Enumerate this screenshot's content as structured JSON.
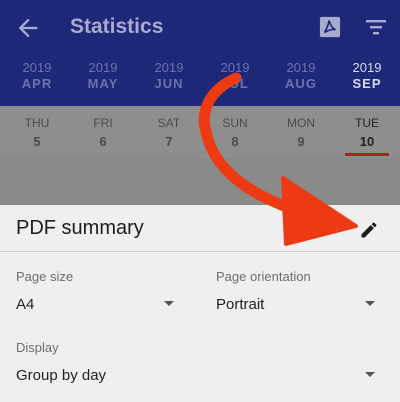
{
  "header": {
    "title": "Statistics",
    "back_icon": "arrow-left-icon",
    "pdf_icon": "pdf-icon",
    "filter_icon": "filter-icon"
  },
  "months": [
    {
      "year": "2019",
      "label": "APR"
    },
    {
      "year": "2019",
      "label": "MAY"
    },
    {
      "year": "2019",
      "label": "JUN"
    },
    {
      "year": "2019",
      "label": "JUL"
    },
    {
      "year": "2019",
      "label": "AUG"
    },
    {
      "year": "2019",
      "label": "SEP",
      "active": true
    }
  ],
  "days": [
    {
      "name": "THU",
      "date": "5"
    },
    {
      "name": "FRI",
      "date": "6"
    },
    {
      "name": "SAT",
      "date": "7"
    },
    {
      "name": "SUN",
      "date": "8"
    },
    {
      "name": "MON",
      "date": "9"
    },
    {
      "name": "TUE",
      "date": "10",
      "active": true
    }
  ],
  "sheet": {
    "title": "PDF summary",
    "page_size_label": "Page size",
    "page_size_value": "A4",
    "orientation_label": "Page orientation",
    "orientation_value": "Portrait",
    "display_label": "Display",
    "display_value": "Group by day"
  },
  "colors": {
    "appbar": "#1e2878",
    "accent": "#9b2a16",
    "annotation_arrow": "#ee3a12"
  }
}
